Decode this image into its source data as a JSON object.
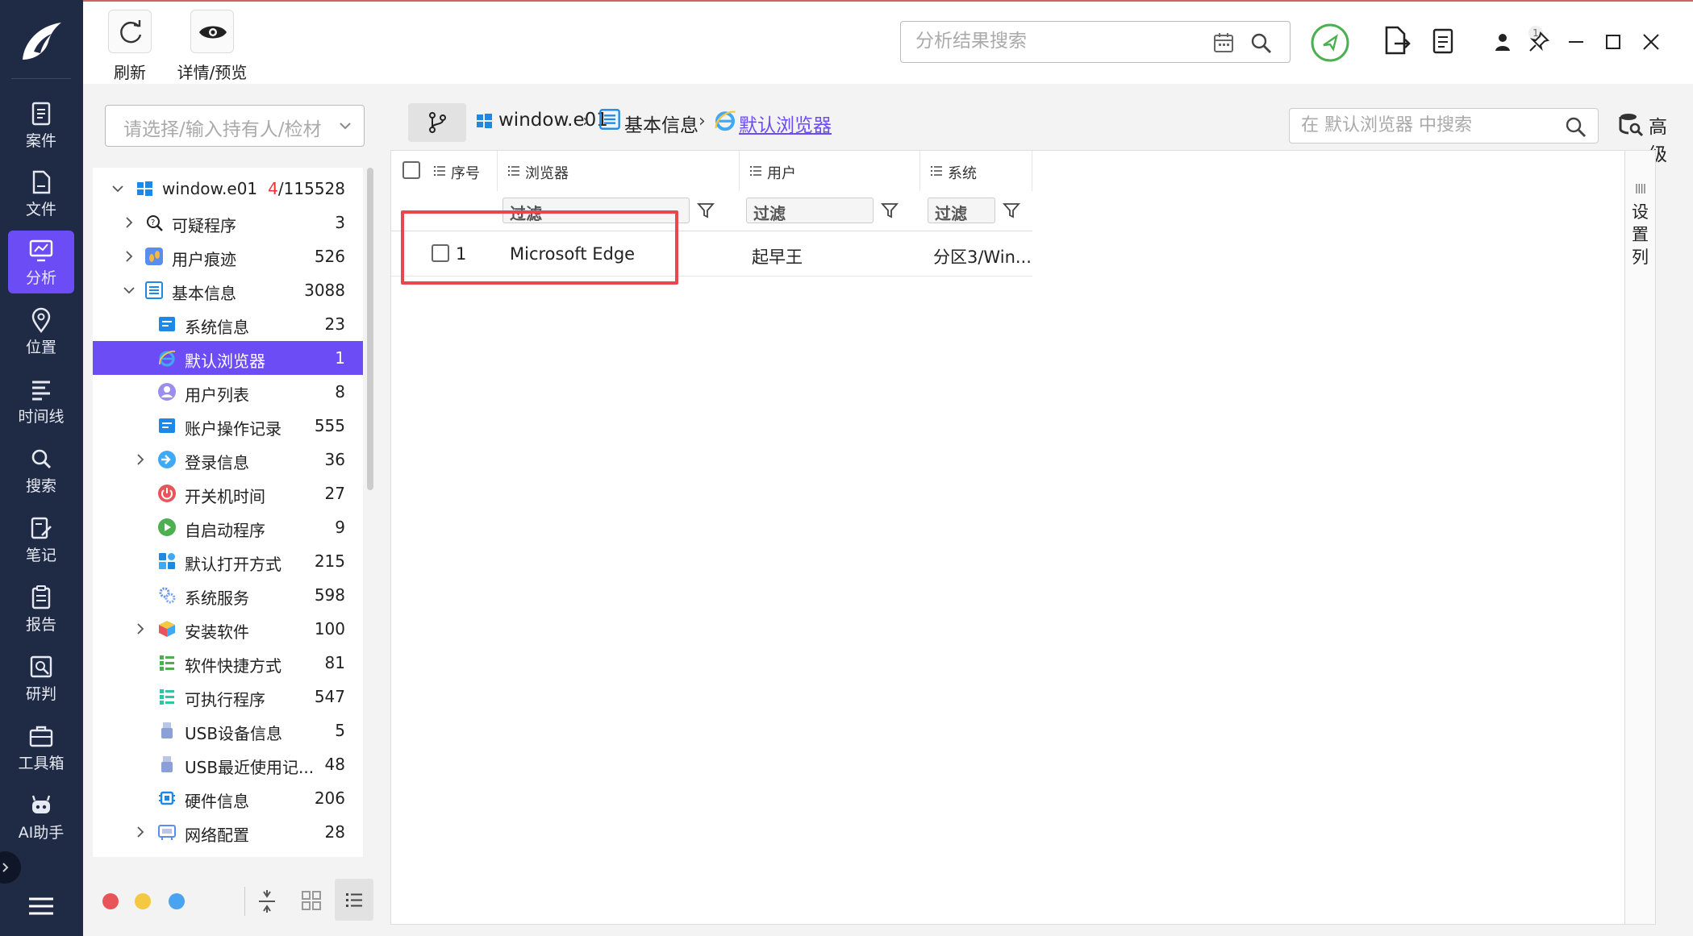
{
  "nav": {
    "items": [
      {
        "label": "案件"
      },
      {
        "label": "文件"
      },
      {
        "label": "分析"
      },
      {
        "label": "位置"
      },
      {
        "label": "时间线"
      },
      {
        "label": "搜索"
      },
      {
        "label": "笔记"
      },
      {
        "label": "报告"
      },
      {
        "label": "研判"
      },
      {
        "label": "工具箱"
      },
      {
        "label": "AI助手"
      }
    ]
  },
  "toolbar": {
    "refresh_label": "刷新",
    "detail_label": "详情/预览",
    "search_placeholder": "分析结果搜索",
    "badge_count": "1"
  },
  "left": {
    "select_placeholder": "请选择/输入持有人/检材",
    "tree": [
      {
        "label": "window.e01",
        "count_red": "4",
        "count": "/115528"
      },
      {
        "label": "可疑程序",
        "count": "3"
      },
      {
        "label": "用户痕迹",
        "count": "526"
      },
      {
        "label": "基本信息",
        "count": "3088"
      },
      {
        "label": "系统信息",
        "count": "23"
      },
      {
        "label": "默认浏览器",
        "count": "1"
      },
      {
        "label": "用户列表",
        "count": "8"
      },
      {
        "label": "账户操作记录",
        "count": "555"
      },
      {
        "label": "登录信息",
        "count": "36"
      },
      {
        "label": "开关机时间",
        "count": "27"
      },
      {
        "label": "自启动程序",
        "count": "9"
      },
      {
        "label": "默认打开方式",
        "count": "215"
      },
      {
        "label": "系统服务",
        "count": "598"
      },
      {
        "label": "安装软件",
        "count": "100"
      },
      {
        "label": "软件快捷方式",
        "count": "81"
      },
      {
        "label": "可执行程序",
        "count": "547"
      },
      {
        "label": "USB设备信息",
        "count": "5"
      },
      {
        "label": "USB最近使用记...",
        "count": "48"
      },
      {
        "label": "硬件信息",
        "count": "206"
      },
      {
        "label": "网络配置",
        "count": "28"
      }
    ],
    "dot_colors": [
      "#e8545a",
      "#f5c842",
      "#4aa3f0"
    ]
  },
  "main": {
    "breadcrumb": [
      "window.e01",
      "基本信息",
      "默认浏览器"
    ],
    "sub_search_placeholder": "在 默认浏览器 中搜索",
    "advanced_label": "高级",
    "columns": [
      "序号",
      "浏览器",
      "用户",
      "系统"
    ],
    "filter_placeholder": "过滤",
    "rows": [
      {
        "index": "1",
        "browser": "Microsoft Edge",
        "user": "起早王",
        "system": "分区3/Win..."
      }
    ],
    "set_columns_label": "设置列"
  },
  "colors": {
    "accent": "#6c4df5",
    "rail": "#1f2a44",
    "highlight_box": "#e8474d",
    "success": "#4caf50"
  }
}
